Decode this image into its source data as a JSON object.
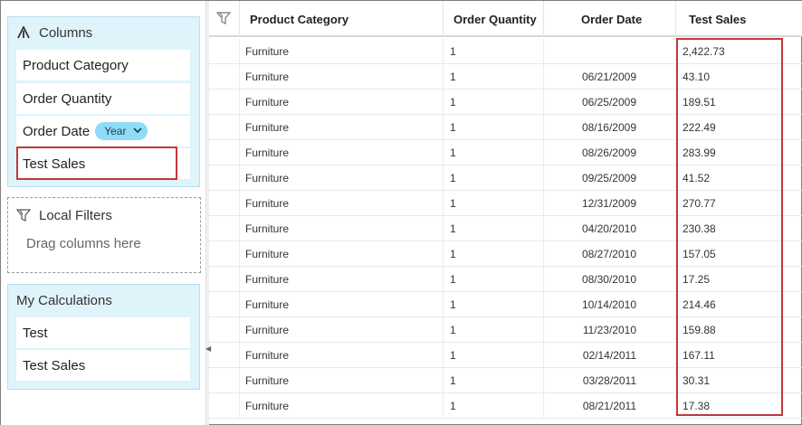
{
  "columns_panel": {
    "title": "Columns",
    "items": [
      {
        "label": "Product Category"
      },
      {
        "label": "Order Quantity"
      },
      {
        "label": "Order Date",
        "badge": "Year"
      },
      {
        "label": "Test Sales"
      }
    ]
  },
  "filters_panel": {
    "title": "Local Filters",
    "hint": "Drag columns here"
  },
  "calculations_panel": {
    "title": "My Calculations",
    "items": [
      {
        "label": "Test"
      },
      {
        "label": "Test Sales"
      }
    ]
  },
  "table": {
    "headers": [
      "Product Category",
      "Order Quantity",
      "Order Date",
      "Test Sales"
    ],
    "rows": [
      [
        "Furniture",
        "1",
        "",
        "2,422.73"
      ],
      [
        "Furniture",
        "1",
        "06/21/2009",
        "43.10"
      ],
      [
        "Furniture",
        "1",
        "06/25/2009",
        "189.51"
      ],
      [
        "Furniture",
        "1",
        "08/16/2009",
        "222.49"
      ],
      [
        "Furniture",
        "1",
        "08/26/2009",
        "283.99"
      ],
      [
        "Furniture",
        "1",
        "09/25/2009",
        "41.52"
      ],
      [
        "Furniture",
        "1",
        "12/31/2009",
        "270.77"
      ],
      [
        "Furniture",
        "1",
        "04/20/2010",
        "230.38"
      ],
      [
        "Furniture",
        "1",
        "08/27/2010",
        "157.05"
      ],
      [
        "Furniture",
        "1",
        "08/30/2010",
        "17.25"
      ],
      [
        "Furniture",
        "1",
        "10/14/2010",
        "214.46"
      ],
      [
        "Furniture",
        "1",
        "11/23/2010",
        "159.88"
      ],
      [
        "Furniture",
        "1",
        "02/14/2011",
        "167.11"
      ],
      [
        "Furniture",
        "1",
        "03/28/2011",
        "30.31"
      ],
      [
        "Furniture",
        "1",
        "08/21/2011",
        "17.38"
      ]
    ]
  },
  "colors": {
    "panel_bg": "#dff3fb",
    "badge_bg": "#8fdcf6",
    "highlight": "#c0393b"
  },
  "icons": {
    "columns": "columns-icon",
    "filter": "filter-icon",
    "grid_filter": "grid-filter-icon"
  }
}
